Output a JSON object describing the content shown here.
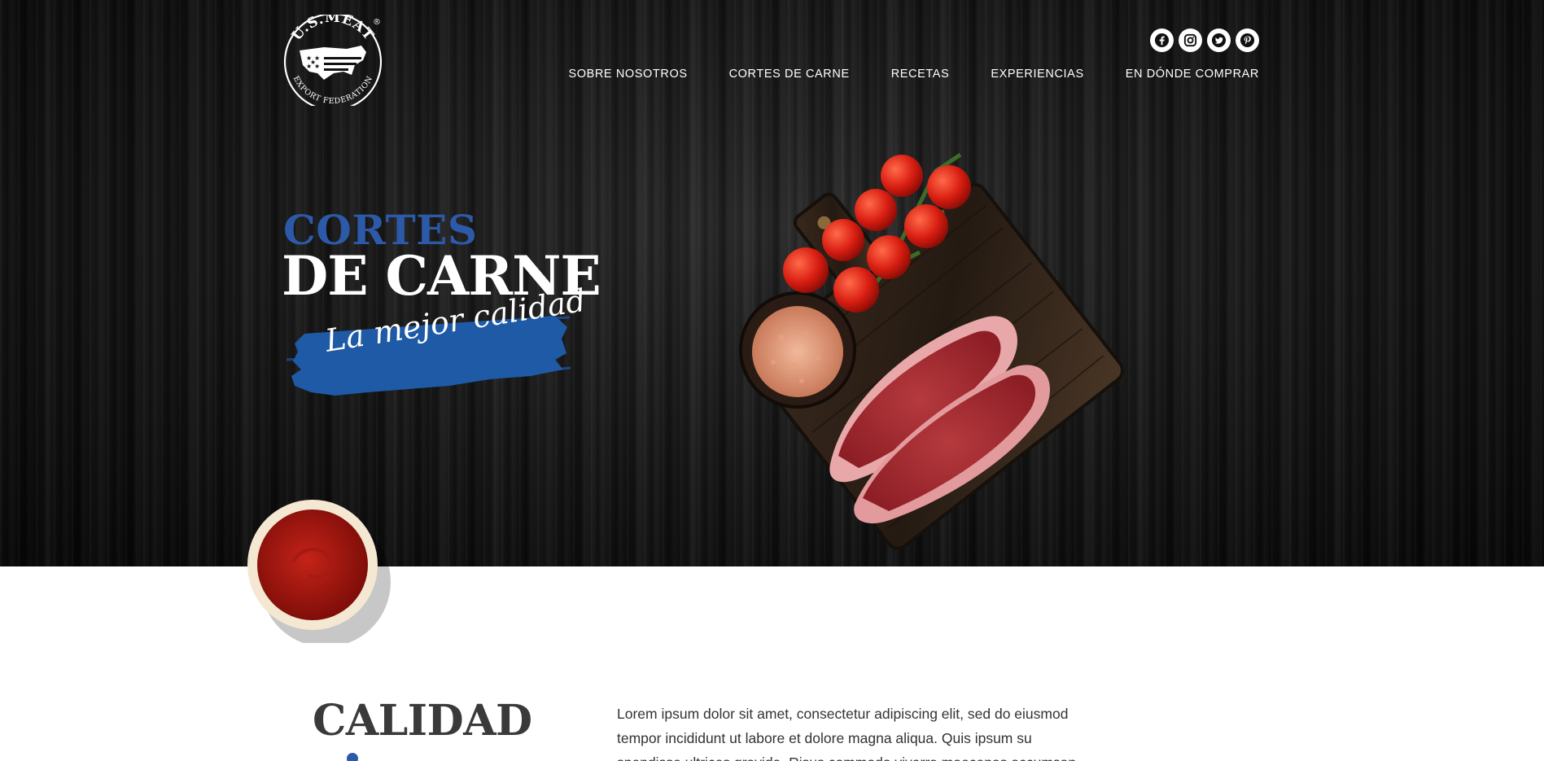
{
  "header": {
    "logo_text_top": "U.S.MEAT",
    "logo_text_bottom": "EXPORT FEDERATION",
    "logo_registered": "®",
    "social_icons": [
      "facebook-icon",
      "instagram-icon",
      "twitter-icon",
      "pinterest-icon"
    ],
    "nav": [
      {
        "label": "SOBRE NOSOTROS"
      },
      {
        "label": "CORTES DE CARNE"
      },
      {
        "label": "RECETAS"
      },
      {
        "label": "EXPERIENCIAS"
      },
      {
        "label": "EN DÓNDE COMPRAR"
      }
    ]
  },
  "hero": {
    "title_small": "CORTES",
    "title_big": "DE CARNE",
    "tagline": "La mejor calidad",
    "accent_color": "#2d5aa8",
    "brush_color": "#1f5aa6"
  },
  "section": {
    "heading": "CALIDAD",
    "body": "Lorem ipsum dolor sit amet, consectetur adipiscing elit, sed do eiusmod tempor incididunt ut labore et dolore magna aliqua. Quis ipsum su spendisse ultrices gravida. Risus commodo viverra maecenas accumsan"
  }
}
